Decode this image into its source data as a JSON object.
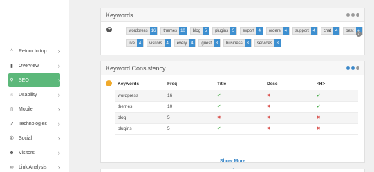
{
  "sidebar": {
    "items": [
      {
        "label": "Return to top",
        "icon": "chevron-up-icon",
        "glyph": "^",
        "active": false
      },
      {
        "label": "Overview",
        "icon": "bar-chart-icon",
        "glyph": "▮",
        "active": false
      },
      {
        "label": "SEO",
        "icon": "search-icon",
        "glyph": "⚲",
        "active": true
      },
      {
        "label": "Usability",
        "icon": "hand-icon",
        "glyph": "☝",
        "active": false
      },
      {
        "label": "Mobile",
        "icon": "mobile-icon",
        "glyph": "▯",
        "active": false
      },
      {
        "label": "Technologies",
        "icon": "rocket-icon",
        "glyph": "➶",
        "active": false
      },
      {
        "label": "Social",
        "icon": "thumbs-up-icon",
        "glyph": "✆",
        "active": false
      },
      {
        "label": "Visitors",
        "icon": "users-icon",
        "glyph": "☻",
        "active": false
      },
      {
        "label": "Link Analysis",
        "icon": "link-icon",
        "glyph": "∞",
        "active": false
      }
    ]
  },
  "keywords": {
    "title": "Keywords",
    "row1": [
      {
        "name": "wordpress",
        "count": "16"
      },
      {
        "name": "themes",
        "count": "10"
      },
      {
        "name": "blog",
        "count": "5"
      },
      {
        "name": "plugins",
        "count": "5"
      },
      {
        "name": "export",
        "count": "4"
      },
      {
        "name": "orders",
        "count": "4"
      },
      {
        "name": "support",
        "count": "4"
      },
      {
        "name": "chat",
        "count": "4"
      },
      {
        "name": "best",
        "count": "4"
      }
    ],
    "row2": [
      {
        "name": "live",
        "count": "4"
      },
      {
        "name": "visitors",
        "count": "4"
      },
      {
        "name": "every",
        "count": "4"
      },
      {
        "name": "guest",
        "count": "3"
      },
      {
        "name": "business",
        "count": "3"
      },
      {
        "name": "services",
        "count": "3"
      }
    ]
  },
  "consistency": {
    "title": "Keyword Consistency",
    "headers": [
      "Keywords",
      "Freq",
      "Title",
      "Desc",
      "<H>"
    ],
    "rows": [
      {
        "keyword": "wordpress",
        "freq": "16",
        "title": true,
        "desc": false,
        "h": true
      },
      {
        "keyword": "themes",
        "freq": "10",
        "title": true,
        "desc": false,
        "h": true
      },
      {
        "keyword": "blog",
        "freq": "5",
        "title": false,
        "desc": false,
        "h": false
      },
      {
        "keyword": "plugins",
        "freq": "5",
        "title": true,
        "desc": false,
        "h": false
      }
    ],
    "show_more": "Show More",
    "colors": {
      "check": "#4cae4c",
      "cross": "#d9534f",
      "accent": "#5cb87a",
      "badge": "#3d8fd0"
    }
  }
}
